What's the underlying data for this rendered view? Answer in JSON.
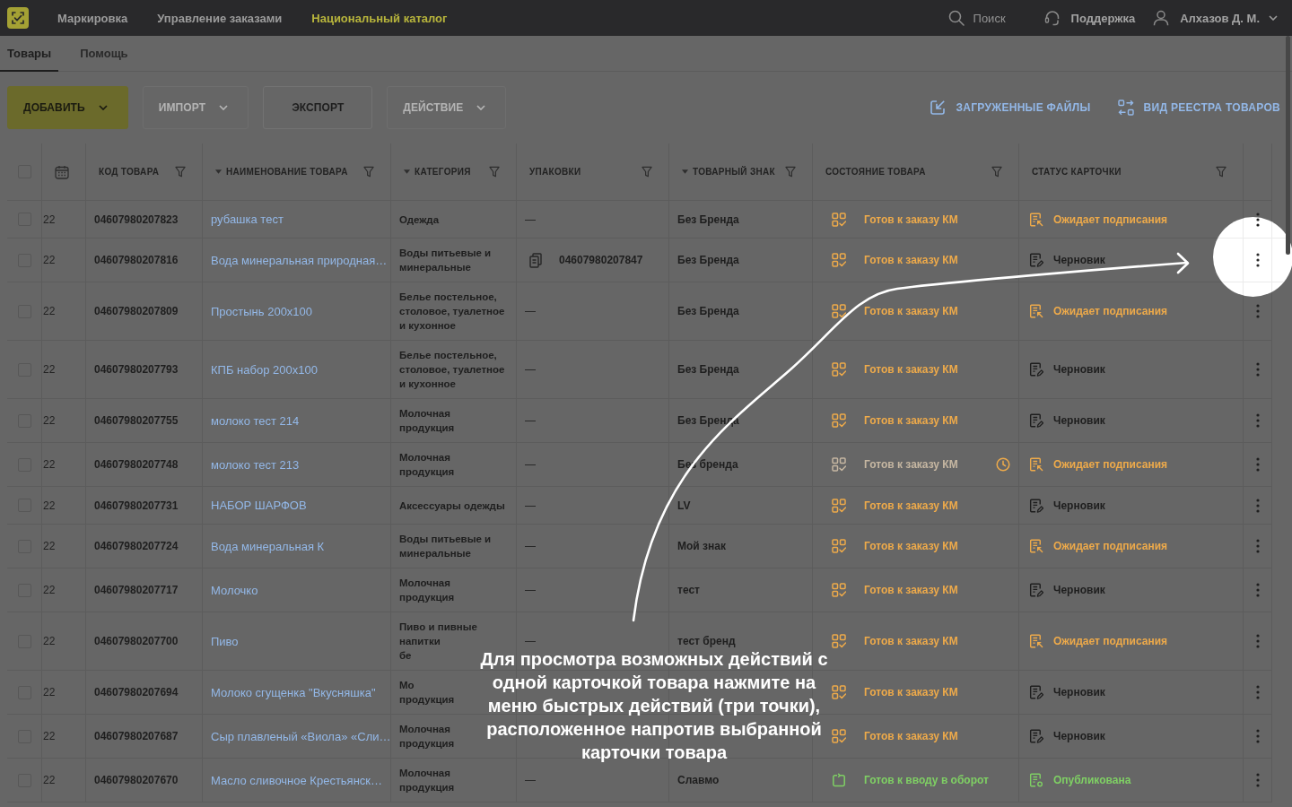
{
  "top_bar": {
    "nav": [
      {
        "label": "Маркировка",
        "selected": false
      },
      {
        "label": "Управление заказами",
        "selected": false
      },
      {
        "label": "Национальный каталог",
        "selected": true
      }
    ],
    "search": {
      "placeholder": "Поиск"
    },
    "support": "Поддержка",
    "user": "Алхазов Д. М."
  },
  "tabs": [
    {
      "label": "Товары",
      "selected": true
    },
    {
      "label": "Помощь",
      "selected": false
    }
  ],
  "toolbar": {
    "buttons": [
      {
        "label": "ДОБАВИТЬ",
        "kind": "primary",
        "dropdown": true,
        "disabled": false
      },
      {
        "label": "ИМПОРТ",
        "kind": "outline",
        "dropdown": true,
        "disabled": true
      },
      {
        "label": "ЭКСПОРТ",
        "kind": "outline",
        "dropdown": false,
        "disabled": false
      },
      {
        "label": "ДЕЙСТВИЕ",
        "kind": "outline",
        "dropdown": true,
        "disabled": true
      }
    ],
    "links": [
      {
        "label": "ЗАГРУЖЕННЫЕ ФАЙЛЫ",
        "kind": "uploads"
      },
      {
        "label": "ВИД РЕЕСТРА ТОВАРОВ",
        "kind": "view"
      }
    ]
  },
  "table": {
    "select_all": {
      "checked": false
    },
    "columns": [
      {
        "label": "КОД ТОВАРА",
        "sorted": false,
        "filter": true
      },
      {
        "label": "НАИМЕНОВАНИЕ ТОВАРА",
        "sorted": true,
        "filter": true
      },
      {
        "label": "КАТЕГОРИЯ",
        "sorted": true,
        "filter": true
      },
      {
        "label": "УПАКОВКИ",
        "sorted": false,
        "filter": true
      },
      {
        "label": "ТОВАРНЫЙ ЗНАК",
        "sorted": true,
        "filter": true
      },
      {
        "label": "СОСТОЯНИЕ ТОВАРА",
        "sorted": false,
        "filter": true
      },
      {
        "label": "СТАТУС КАРТОЧКИ",
        "sorted": false,
        "filter": true
      }
    ],
    "rows": [
      {
        "checked": false,
        "date": "22",
        "code": "04607980207823",
        "name": "рубашка тест",
        "category": "Одежда",
        "pack": {
          "kind": "dash",
          "text": "—"
        },
        "brand": "Без Бренда",
        "state": {
          "kind": "ready_order",
          "label": "Готов к заказу КМ",
          "pending": false
        },
        "card": {
          "kind": "awaiting",
          "label": "Ожидает подписания"
        },
        "spotlight": false
      },
      {
        "checked": false,
        "date": "22",
        "code": "04607980207816",
        "name": "Вода минеральная природная…",
        "category": "Воды питьевые и\nминеральные",
        "pack": {
          "kind": "code",
          "text": "04607980207847"
        },
        "brand": "Без Бренда",
        "state": {
          "kind": "ready_order",
          "label": "Готов к заказу КМ",
          "pending": false
        },
        "card": {
          "kind": "draft",
          "label": "Черновик"
        },
        "spotlight": true
      },
      {
        "checked": false,
        "date": "22",
        "code": "04607980207809",
        "name": "Простынь 200х100",
        "category": "Белье постельное,\nстоловое, туалетное\nи кухонное",
        "pack": {
          "kind": "dash",
          "text": "—"
        },
        "brand": "Без Бренда",
        "state": {
          "kind": "ready_order",
          "label": "Готов к заказу КМ",
          "pending": false
        },
        "card": {
          "kind": "awaiting",
          "label": "Ожидает подписания"
        },
        "spotlight": false
      },
      {
        "checked": false,
        "date": "22",
        "code": "04607980207793",
        "name": "КПБ набор 200х100",
        "category": "Белье постельное,\nстоловое, туалетное\nи кухонное",
        "pack": {
          "kind": "dash",
          "text": "—"
        },
        "brand": "Без Бренда",
        "state": {
          "kind": "ready_order",
          "label": "Готов к заказу КМ",
          "pending": false
        },
        "card": {
          "kind": "draft",
          "label": "Черновик"
        },
        "spotlight": false
      },
      {
        "checked": false,
        "date": "22",
        "code": "04607980207755",
        "name": "молоко тест 214",
        "category": "Молочная\nпродукция",
        "pack": {
          "kind": "dash",
          "text": "—"
        },
        "brand": "Без Бренда",
        "state": {
          "kind": "ready_order",
          "label": "Готов к заказу КМ",
          "pending": false
        },
        "card": {
          "kind": "draft",
          "label": "Черновик"
        },
        "spotlight": false
      },
      {
        "checked": false,
        "date": "22",
        "code": "04607980207748",
        "name": "молоко тест 213",
        "category": "Молочная\nпродукция",
        "pack": {
          "kind": "dash",
          "text": "—"
        },
        "brand": "Без бренда",
        "state": {
          "kind": "ready_order",
          "label": "Готов к заказу КМ",
          "pending": true
        },
        "card": {
          "kind": "awaiting",
          "label": "Ожидает подписания"
        },
        "spotlight": false
      },
      {
        "checked": false,
        "date": "22",
        "code": "04607980207731",
        "name": "НАБОР ШАРФОВ",
        "category": "Аксессуары одежды",
        "pack": {
          "kind": "dash",
          "text": "—"
        },
        "brand": "LV",
        "state": {
          "kind": "ready_order",
          "label": "Готов к заказу КМ",
          "pending": false
        },
        "card": {
          "kind": "draft",
          "label": "Черновик"
        },
        "spotlight": false
      },
      {
        "checked": false,
        "date": "22",
        "code": "04607980207724",
        "name": "Вода минеральная К",
        "category": "Воды питьевые и\nминеральные",
        "pack": {
          "kind": "dash",
          "text": "—"
        },
        "brand": "Мой знак",
        "state": {
          "kind": "ready_order",
          "label": "Готов к заказу КМ",
          "pending": false
        },
        "card": {
          "kind": "awaiting",
          "label": "Ожидает подписания"
        },
        "spotlight": false
      },
      {
        "checked": false,
        "date": "22",
        "code": "04607980207717",
        "name": "Молочко",
        "category": "Молочная\nпродукция",
        "pack": {
          "kind": "dash",
          "text": "—"
        },
        "brand": "тест",
        "state": {
          "kind": "ready_order",
          "label": "Готов к заказу КМ",
          "pending": false
        },
        "card": {
          "kind": "draft",
          "label": "Черновик"
        },
        "spotlight": false
      },
      {
        "checked": false,
        "date": "22",
        "code": "04607980207700",
        "name": "Пиво",
        "category": "Пиво и пивные\nнапитки\nбе",
        "pack": {
          "kind": "dash",
          "text": "—"
        },
        "brand": "тест бренд",
        "state": {
          "kind": "ready_order",
          "label": "Готов к заказу КМ",
          "pending": false
        },
        "card": {
          "kind": "awaiting",
          "label": "Ожидает подписания"
        },
        "spotlight": false
      },
      {
        "checked": false,
        "date": "22",
        "code": "04607980207694",
        "name": "Молоко сгущенка \"Вкусняшка\"",
        "category": "Мо\nпродукция",
        "state": {
          "kind": "ready_order",
          "label": "Готов к заказу КМ",
          "pending": false
        },
        "card": {
          "kind": "draft",
          "label": "Черновик"
        },
        "spotlight": false
      },
      {
        "checked": false,
        "date": "22",
        "code": "04607980207687",
        "name": "Сыр плавленый «Виола» «Сли…",
        "category": "Молочная\nпродукция",
        "state": {
          "kind": "ready_order",
          "label": "Готов к заказу КМ",
          "pending": false
        },
        "card": {
          "kind": "draft",
          "label": "Черновик"
        },
        "spotlight": false
      },
      {
        "checked": false,
        "date": "22",
        "code": "04607980207670",
        "name": "Масло сливочное Крестьянск…",
        "category": "Молочная\nпродукция",
        "pack": {
          "kind": "dash",
          "text": "—"
        },
        "brand": "Славмо",
        "state": {
          "kind": "ready_circulation",
          "label": "Готов к вводу в оборот",
          "pending": false
        },
        "card": {
          "kind": "published",
          "label": "Опубликована"
        },
        "spotlight": false
      }
    ]
  },
  "tutorial": {
    "caption": "Для просмотра возможных действий с одной карточкой товара нажмите на меню быстрых действий (три точки), расположенное напротив выбранной карточки товара"
  }
}
